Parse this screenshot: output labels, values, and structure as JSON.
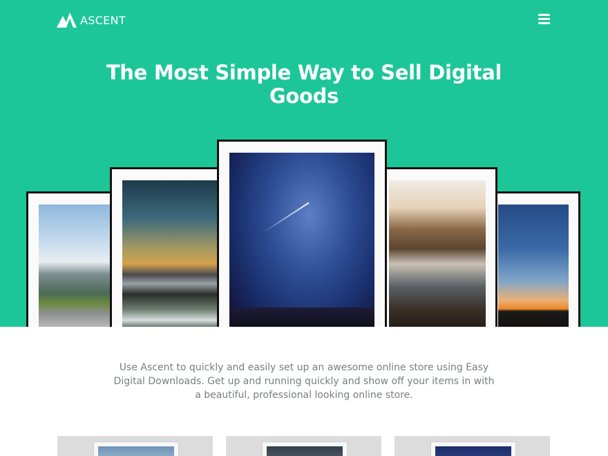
{
  "header": {
    "logo_text": "ASCENT",
    "logo_icon": "mountain-icon",
    "menu_icon": "hamburger-menu-icon"
  },
  "hero": {
    "title": "The Most Simple Way to Sell Digital Goods",
    "background_color": "#1dc698"
  },
  "intro": {
    "text": "Use Ascent to quickly and easily set up an awesome online store using Easy Digital Downloads. Get up and running quickly and show off your items in with a beautiful, professional looking online store."
  },
  "gallery": {
    "frames": [
      {
        "subject": "mountain-road-photo"
      },
      {
        "subject": "mountain-sunset-photo"
      },
      {
        "subject": "starry-night-sky-photo"
      },
      {
        "subject": "waterfall-photo"
      },
      {
        "subject": "silhouette-sunset-photo"
      }
    ]
  },
  "products": [
    {
      "subject": "product-thumbnail-1"
    },
    {
      "subject": "product-thumbnail-2"
    },
    {
      "subject": "product-thumbnail-3"
    }
  ]
}
